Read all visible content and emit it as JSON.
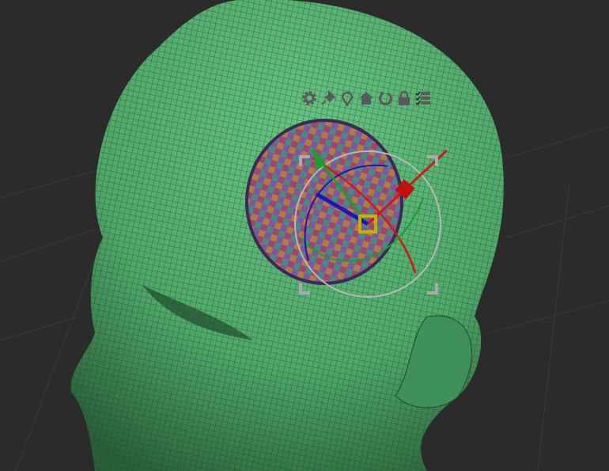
{
  "viewport": {
    "name": "3D viewport",
    "model": "head-mesh"
  },
  "gizmo_toolbar": {
    "icons": [
      "gear-icon",
      "pin-icon",
      "location-pin-icon",
      "home-icon",
      "reset-rotation-icon",
      "lock-icon",
      "checklist-icon"
    ]
  },
  "colors": {
    "background": "#2b2b2b",
    "grid": "#3a3a3a",
    "mesh": "#4fa86a",
    "mesh_dark": "#2f6e42",
    "wire": "#1d3d26",
    "axis_x": "#d01818",
    "axis_y": "#1aa02a",
    "axis_z": "#1a1ab0",
    "gizmo_ring": "#b8b8b8",
    "pivot": "#c8b000",
    "icon": "#5a5a5a"
  }
}
